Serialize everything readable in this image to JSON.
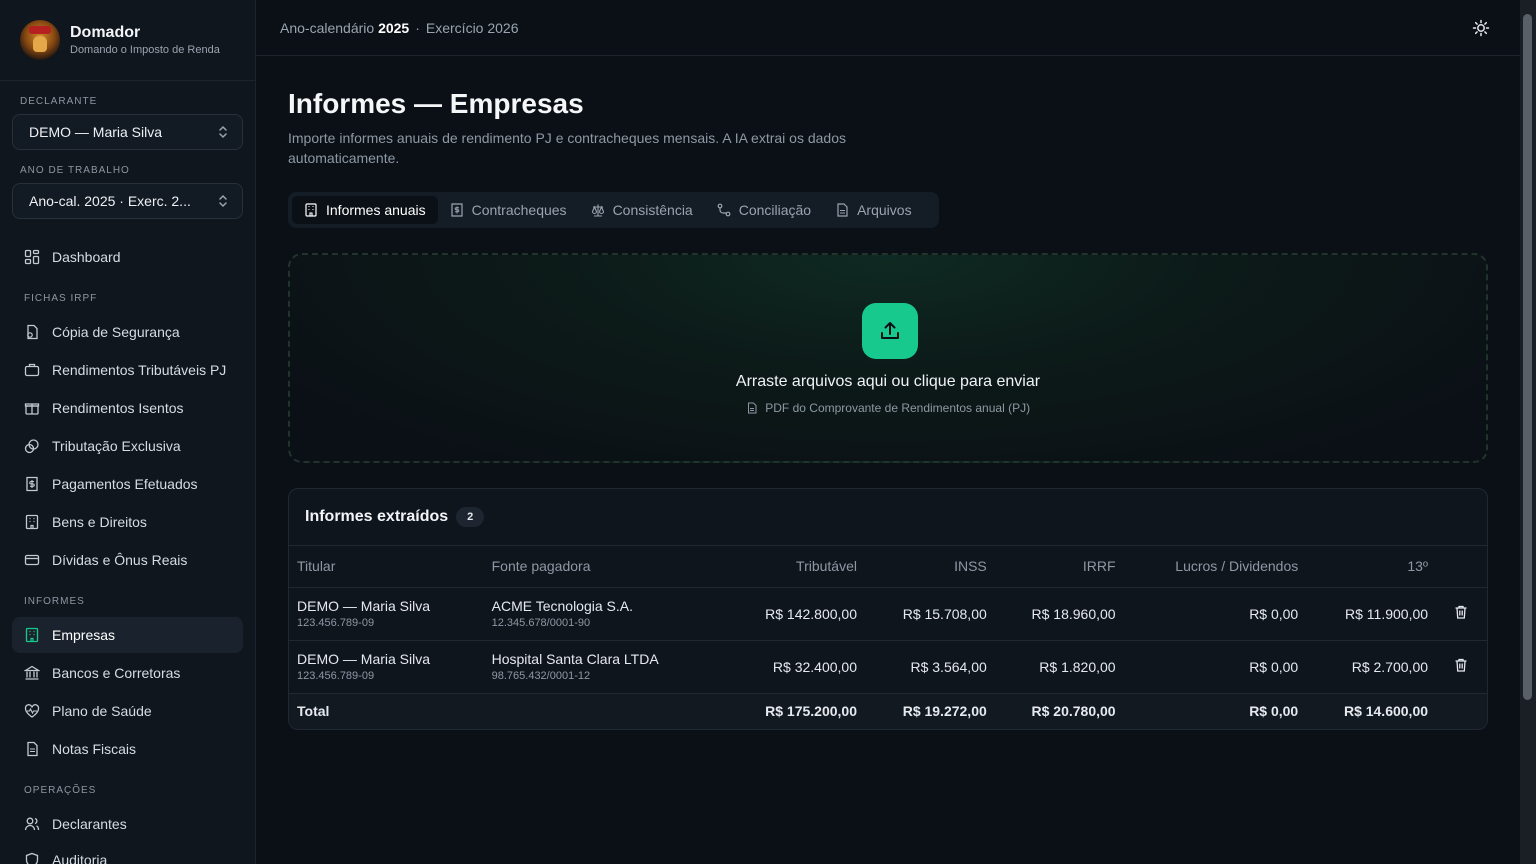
{
  "brand": {
    "title": "Domador",
    "subtitle": "Domando o Imposto de Renda"
  },
  "declarante": {
    "label": "DECLARANTE",
    "value": "DEMO — Maria Silva"
  },
  "ano": {
    "label": "ANO DE TRABALHO",
    "value": "Ano-cal. 2025 · Exerc. 2..."
  },
  "nav": {
    "dashboard": "Dashboard",
    "fichas_label": "FICHAS IRPF",
    "fichas": [
      "Cópia de Segurança",
      "Rendimentos Tributáveis PJ",
      "Rendimentos Isentos",
      "Tributação Exclusiva",
      "Pagamentos Efetuados",
      "Bens e Direitos",
      "Dívidas e Ônus Reais"
    ],
    "informes_label": "INFORMES",
    "informes": [
      "Empresas",
      "Bancos e Corretoras",
      "Plano de Saúde",
      "Notas Fiscais"
    ],
    "operacoes_label": "OPERAÇÕES",
    "operacoes": [
      "Declarantes",
      "Auditoria"
    ]
  },
  "topbar": {
    "prefix": "Ano-calendário",
    "year": "2025",
    "sep": "·",
    "exercicio": "Exercício 2026"
  },
  "page": {
    "title": "Informes — Empresas",
    "subtitle": "Importe informes anuais de rendimento PJ e contracheques mensais. A IA extrai os dados automaticamente."
  },
  "tabs": [
    "Informes anuais",
    "Contracheques",
    "Consistência",
    "Conciliação",
    "Arquivos"
  ],
  "dropzone": {
    "title": "Arraste arquivos aqui ou clique para enviar",
    "hint": "PDF do Comprovante de Rendimentos anual (PJ)"
  },
  "table": {
    "title": "Informes extraídos",
    "count": "2",
    "headers": [
      "Titular",
      "Fonte pagadora",
      "Tributável",
      "INSS",
      "IRRF",
      "Lucros / Dividendos",
      "13º"
    ],
    "rows": [
      {
        "titular": "DEMO — Maria Silva",
        "cpf": "123.456.789-09",
        "fonte": "ACME Tecnologia S.A.",
        "cnpj": "12.345.678/0001-90",
        "tributavel": "R$ 142.800,00",
        "inss": "R$ 15.708,00",
        "irrf": "R$ 18.960,00",
        "lucros": "R$ 0,00",
        "decimo": "R$ 11.900,00"
      },
      {
        "titular": "DEMO — Maria Silva",
        "cpf": "123.456.789-09",
        "fonte": "Hospital Santa Clara LTDA",
        "cnpj": "98.765.432/0001-12",
        "tributavel": "R$ 32.400,00",
        "inss": "R$ 3.564,00",
        "irrf": "R$ 1.820,00",
        "lucros": "R$ 0,00",
        "decimo": "R$ 2.700,00"
      }
    ],
    "total": {
      "label": "Total",
      "tributavel": "R$ 175.200,00",
      "inss": "R$ 19.272,00",
      "irrf": "R$ 20.780,00",
      "lucros": "R$ 0,00",
      "decimo": "R$ 14.600,00"
    }
  },
  "colors": {
    "accent": "#18c98e",
    "background": "#0b1016",
    "sidebar": "#0f161e"
  }
}
